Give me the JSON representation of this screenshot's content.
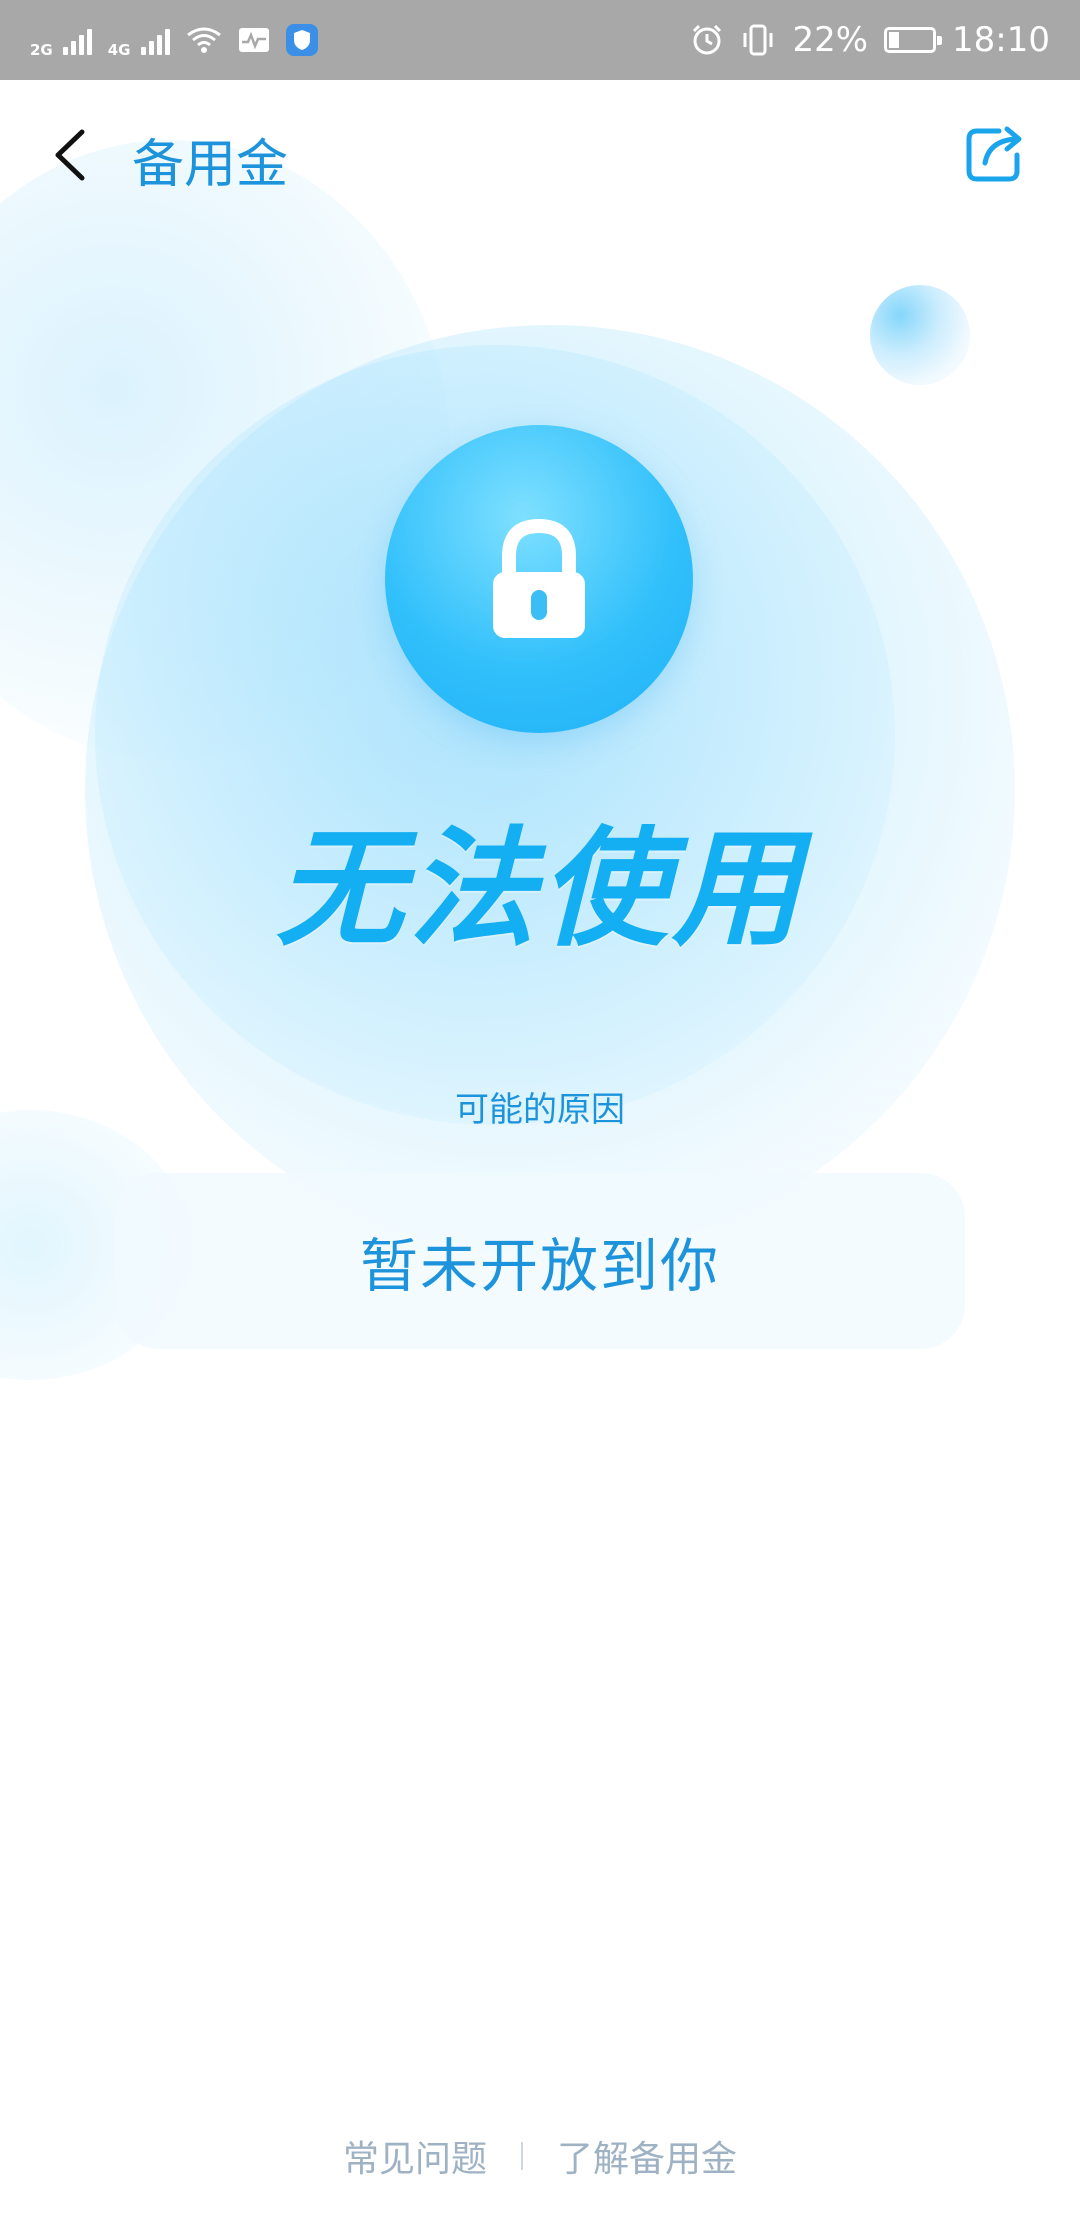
{
  "status_bar": {
    "network_1": "2G",
    "network_2": "4G",
    "battery_percent": "22%",
    "time": "18:10",
    "battery_level": 0.22
  },
  "nav": {
    "title": "备用金",
    "back_icon": "chevron-left-icon",
    "share_icon": "share-icon"
  },
  "main": {
    "lock_icon": "lock-icon",
    "status_title": "无法使用",
    "reason_label": "可能的原因",
    "reason_text": "暂未开放到你"
  },
  "footer": {
    "faq_label": "常见问题",
    "learn_label": "了解备用金"
  },
  "colors": {
    "accent": "#1d93dc",
    "title_blue": "#14aef2",
    "status_bar_bg": "#a8a8a8",
    "footer_text": "#9fb2c3"
  }
}
